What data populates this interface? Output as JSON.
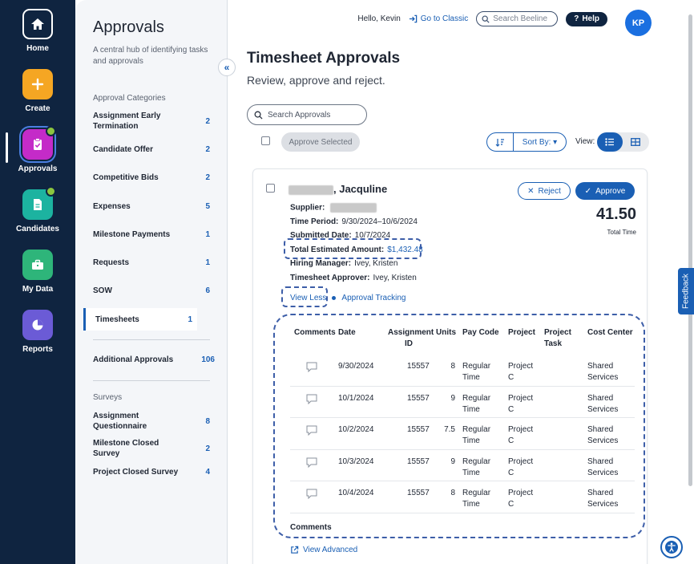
{
  "rail": {
    "items": [
      {
        "label": "Home",
        "icon": "home-icon",
        "bg": "#ffffff"
      },
      {
        "label": "Create",
        "icon": "plus-icon",
        "bg": "#f5a623"
      },
      {
        "label": "Approvals",
        "icon": "clipboard-check-icon",
        "bg": "#c42bc8"
      },
      {
        "label": "Candidates",
        "icon": "document-icon",
        "bg": "#1cb3a0"
      },
      {
        "label": "My Data",
        "icon": "briefcase-icon",
        "bg": "#2eb57a"
      },
      {
        "label": "Reports",
        "icon": "pie-chart-icon",
        "bg": "#6b5bd6"
      }
    ]
  },
  "panel": {
    "title": "Approvals",
    "subtitle": "A central hub of identifying tasks and approvals",
    "categories_label": "Approval Categories",
    "categories": [
      {
        "label": "Assignment Early Termination",
        "count": "2"
      },
      {
        "label": "Candidate Offer",
        "count": "2"
      },
      {
        "label": "Competitive Bids",
        "count": "2"
      },
      {
        "label": "Expenses",
        "count": "5"
      },
      {
        "label": "Milestone Payments",
        "count": "1"
      },
      {
        "label": "Requests",
        "count": "1"
      },
      {
        "label": "SOW",
        "count": "6"
      },
      {
        "label": "Timesheets",
        "count": "1"
      }
    ],
    "additional": {
      "label": "Additional Approvals",
      "count": "106"
    },
    "surveys_label": "Surveys",
    "surveys": [
      {
        "label": "Assignment Questionnaire",
        "count": "8"
      },
      {
        "label": "Milestone Closed Survey",
        "count": "2"
      },
      {
        "label": "Project Closed Survey",
        "count": "4"
      }
    ]
  },
  "topbar": {
    "greeting": "Hello, Kevin",
    "classic": "Go to Classic",
    "search_placeholder": "Search Beeline",
    "help": "Help",
    "avatar": "KP"
  },
  "main": {
    "title": "Timesheet Approvals",
    "subtitle": "Review, approve and reject.",
    "search_placeholder": "Search Approvals",
    "approve_selected": "Approve Selected",
    "sort_by": "Sort By:",
    "view_label": "View:"
  },
  "card": {
    "name_suffix": ", Jacquline",
    "reject": "Reject",
    "approve": "Approve",
    "total_time": "41.50",
    "total_time_label": "Total Time",
    "supplier_label": "Supplier:",
    "time_period_label": "Time Period:",
    "time_period": "9/30/2024–10/6/2024",
    "submitted_label": "Submitted Date:",
    "submitted": "10/7/2024",
    "amount_label": "Total Estimated Amount:",
    "amount": "$1,432.48",
    "manager_label": "Hiring Manager:",
    "manager": "Ivey, Kristen",
    "approver_label": "Timesheet Approver:",
    "approver": "Ivey, Kristen",
    "view_less": "View Less",
    "approval_tracking": "Approval Tracking",
    "table": {
      "headers": [
        "Comments",
        "Date",
        "Assignment ID",
        "Units",
        "Pay Code",
        "Project",
        "Project Task",
        "Cost Center"
      ],
      "rows": [
        {
          "date": "9/30/2024",
          "assignment_id": "15557",
          "units": "8",
          "pay_code": "Regular Time",
          "project": "Project C",
          "task": "",
          "cost_center": "Shared Services"
        },
        {
          "date": "10/1/2024",
          "assignment_id": "15557",
          "units": "9",
          "pay_code": "Regular Time",
          "project": "Project C",
          "task": "",
          "cost_center": "Shared Services"
        },
        {
          "date": "10/2/2024",
          "assignment_id": "15557",
          "units": "7.5",
          "pay_code": "Regular Time",
          "project": "Project C",
          "task": "",
          "cost_center": "Shared Services"
        },
        {
          "date": "10/3/2024",
          "assignment_id": "15557",
          "units": "9",
          "pay_code": "Regular Time",
          "project": "Project C",
          "task": "",
          "cost_center": "Shared Services"
        },
        {
          "date": "10/4/2024",
          "assignment_id": "15557",
          "units": "8",
          "pay_code": "Regular Time",
          "project": "Project C",
          "task": "",
          "cost_center": "Shared Services"
        }
      ]
    },
    "comments_footer": "Comments",
    "view_advanced": "View Advanced"
  },
  "feedback": "Feedback",
  "colors": {
    "brand": "#1a5fb4",
    "rail": "#0f2440",
    "annotation": "#3d5ea8"
  }
}
